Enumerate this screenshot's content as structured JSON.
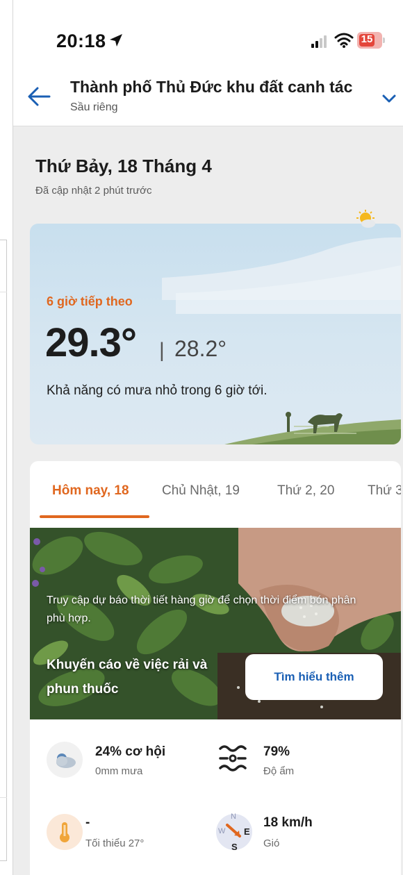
{
  "status": {
    "time": "20:18",
    "battery": "15"
  },
  "header": {
    "title": "Thành phố Thủ Đức khu đất canh tác",
    "subtitle": "Sầu riêng"
  },
  "date": {
    "title": "Thứ Bảy, 18 Tháng 4",
    "updated": "Đã cập nhật 2 phút trước"
  },
  "forecast": {
    "label": "6 giờ tiếp theo",
    "temp_main": "29.3°",
    "separator": "|",
    "temp_secondary": "28.2°",
    "description": "Khả năng có mưa nhỏ trong 6 giờ tới."
  },
  "tabs": [
    {
      "label": "Hôm nay, 18"
    },
    {
      "label": "Chủ Nhật, 19"
    },
    {
      "label": "Thứ 2, 20"
    },
    {
      "label": "Thứ 3"
    }
  ],
  "promo": {
    "text": "Truy cập dự báo thời tiết hàng giờ để chọn thời điểm bón phân phù hợp.",
    "heading": "Khuyến cáo về việc rải và phun thuốc",
    "button": "Tìm hiểu thêm"
  },
  "stats": {
    "rain": {
      "value": "24% cơ hội",
      "label": "0mm mưa",
      "icon": "cloud-rain-icon"
    },
    "humidity": {
      "value": "79%",
      "label": "Độ ẩm",
      "icon": "humidity-waves-icon"
    },
    "temperature": {
      "value": "-",
      "label": "Tối thiểu 27°",
      "icon": "thermometer-icon"
    },
    "wind": {
      "value": "18 km/h",
      "label": "Gió",
      "icon": "compass-icon",
      "compass": {
        "n": "N",
        "e": "E",
        "s": "S",
        "w": "W"
      }
    }
  },
  "colors": {
    "accent": "#e0671f",
    "link": "#1a5fb4",
    "background": "#ededed"
  }
}
